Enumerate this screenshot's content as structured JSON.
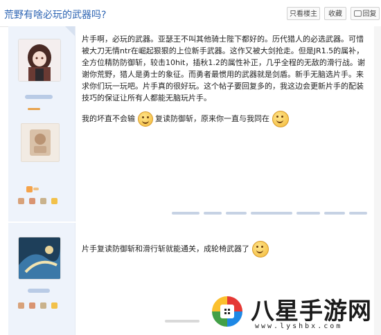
{
  "header": {
    "title": "荒野有啥必玩的武器吗?",
    "buttons": {
      "only_op": "只看楼主",
      "favorite": "收藏",
      "reply": "回复"
    }
  },
  "post1": {
    "paragraph1": "片手啊，必玩的武器。亚瑟王不叫其他骑士陛下都好的。历代猎人的必选武器。可惜被大刀无情ntr在崛起狠狠的上位新手武器。这作又被大剑抢走。但是JR1.5的属补，全方位精防防御斩，较击10hit，插秋1.2的属性补正，几乎全程的无敌的滑行战。谢谢你荒野，猎人是勇士的象征。而勇者最惯用的武器就是剑盾。新手无脑选片手。来求你们玩一玩吧。片手真的很好玩。这个帖子要回复多的，我这边会更新片手的配装技巧的保证让所有人都能无脑玩片手。",
    "line2_a": "我的坏直不会输",
    "line2_b": "复读防御斩，原来你一直与我同在"
  },
  "post2": {
    "text": "片手复读防御斩和滑行斩就能通关，成轮椅武器了"
  },
  "watermark": {
    "logo_text": "八星手游网",
    "url": "www.lyshbx.com"
  },
  "icons": [
    "reply-icon",
    "smile-emoji-icon",
    "watermark-logo-icon"
  ]
}
